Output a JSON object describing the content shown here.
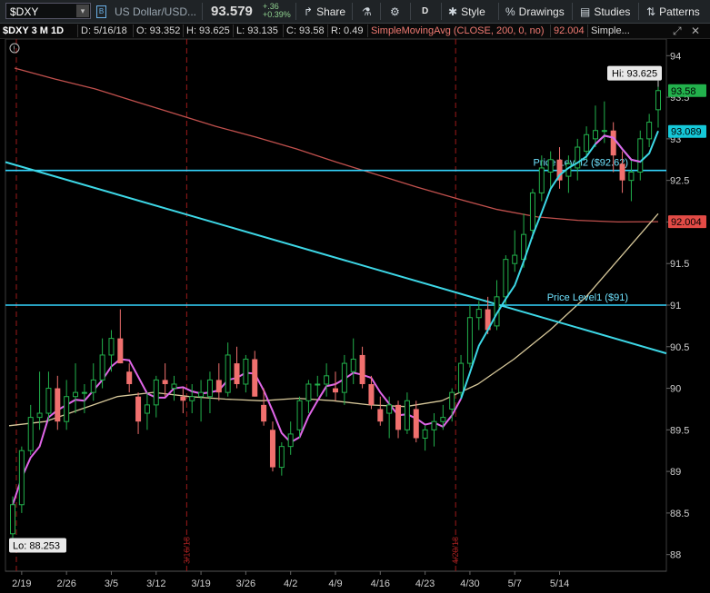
{
  "toolbar": {
    "symbol": "$DXY",
    "description": "US Dollar/USD...",
    "last": "93.579",
    "change": "+.36",
    "change_pct": "+0.39%",
    "period_button": "D",
    "buttons": {
      "share": "Share",
      "style": "Style",
      "drawings": "Drawings",
      "studies": "Studies",
      "patterns": "Patterns"
    }
  },
  "infobar": {
    "title": "$DXY 3 M 1D",
    "date": "D: 5/16/18",
    "open": "O: 93.352",
    "high": "H: 93.625",
    "low": "L: 93.135",
    "close": "C: 93.58",
    "range": "R: 0.49",
    "study": "SimpleMovingAvg (CLOSE, 200, 0, no)",
    "study_value": "92.004",
    "study2": "Simple..."
  },
  "colors": {
    "up": "#22b14c",
    "down": "#f0706e",
    "sma200": "#c0504d",
    "sma_fast": "#e066e8",
    "sma_slow": "#d7c89a",
    "trendline": "#3dd7e6",
    "level": "#35d6ff",
    "vline": "#9b1a1a"
  },
  "chart_data": {
    "type": "candlestick",
    "ylim": [
      87.8,
      94.2
    ],
    "y_ticks": [
      88,
      88.5,
      89,
      89.5,
      90,
      90.5,
      91,
      91.5,
      92,
      92.5,
      93,
      93.5,
      94
    ],
    "y_tick_labels": [
      "88",
      "88.5",
      "89",
      "89.5",
      "90",
      "90.5",
      "91",
      "91.5",
      "92",
      "92.5",
      "93",
      "93.5",
      "94"
    ],
    "x_ticks": [
      "2/19",
      "2/26",
      "3/5",
      "3/12",
      "3/19",
      "3/26",
      "4/2",
      "4/9",
      "4/16",
      "4/23",
      "4/30",
      "5/7",
      "5/14"
    ],
    "event_dates": [
      "3/16/18",
      "4/20/18"
    ],
    "candles": [
      {
        "o": 88.25,
        "h": 88.7,
        "l": 88.2,
        "c": 88.6
      },
      {
        "o": 88.6,
        "h": 89.3,
        "l": 88.5,
        "c": 89.25
      },
      {
        "o": 89.25,
        "h": 89.8,
        "l": 89.2,
        "c": 89.65
      },
      {
        "o": 89.65,
        "h": 90.2,
        "l": 89.5,
        "c": 89.7
      },
      {
        "o": 89.7,
        "h": 90.2,
        "l": 89.6,
        "c": 90.0
      },
      {
        "o": 90.0,
        "h": 90.15,
        "l": 89.5,
        "c": 89.6
      },
      {
        "o": 89.6,
        "h": 90.1,
        "l": 89.5,
        "c": 89.9
      },
      {
        "o": 89.9,
        "h": 90.3,
        "l": 89.7,
        "c": 89.95
      },
      {
        "o": 89.95,
        "h": 90.05,
        "l": 89.7,
        "c": 89.95
      },
      {
        "o": 89.95,
        "h": 90.3,
        "l": 89.85,
        "c": 90.1
      },
      {
        "o": 90.1,
        "h": 90.6,
        "l": 90.0,
        "c": 90.4
      },
      {
        "o": 90.4,
        "h": 90.7,
        "l": 90.2,
        "c": 90.6
      },
      {
        "o": 90.6,
        "h": 90.95,
        "l": 90.3,
        "c": 90.3
      },
      {
        "o": 90.2,
        "h": 90.3,
        "l": 89.95,
        "c": 90.05
      },
      {
        "o": 89.9,
        "h": 89.95,
        "l": 89.45,
        "c": 89.6
      },
      {
        "o": 89.7,
        "h": 89.95,
        "l": 89.5,
        "c": 89.8
      },
      {
        "o": 89.8,
        "h": 90.15,
        "l": 89.65,
        "c": 90.1
      },
      {
        "o": 90.1,
        "h": 90.3,
        "l": 89.9,
        "c": 90.05
      },
      {
        "o": 90.0,
        "h": 90.15,
        "l": 89.85,
        "c": 90.05
      },
      {
        "o": 89.9,
        "h": 90.0,
        "l": 89.7,
        "c": 89.85
      },
      {
        "o": 89.85,
        "h": 90.05,
        "l": 89.7,
        "c": 89.9
      },
      {
        "o": 89.9,
        "h": 90.1,
        "l": 89.6,
        "c": 89.95
      },
      {
        "o": 89.9,
        "h": 90.2,
        "l": 89.7,
        "c": 90.1
      },
      {
        "o": 90.1,
        "h": 90.3,
        "l": 89.85,
        "c": 89.95
      },
      {
        "o": 89.95,
        "h": 90.55,
        "l": 89.9,
        "c": 90.4
      },
      {
        "o": 90.3,
        "h": 90.5,
        "l": 90.0,
        "c": 90.05
      },
      {
        "o": 90.05,
        "h": 90.4,
        "l": 89.95,
        "c": 90.35
      },
      {
        "o": 90.35,
        "h": 90.45,
        "l": 89.9,
        "c": 89.9
      },
      {
        "o": 89.8,
        "h": 90.0,
        "l": 89.55,
        "c": 89.6
      },
      {
        "o": 89.5,
        "h": 89.6,
        "l": 89.0,
        "c": 89.05
      },
      {
        "o": 89.05,
        "h": 89.35,
        "l": 88.95,
        "c": 89.3
      },
      {
        "o": 89.3,
        "h": 89.6,
        "l": 89.2,
        "c": 89.45
      },
      {
        "o": 89.5,
        "h": 89.9,
        "l": 89.4,
        "c": 89.85
      },
      {
        "o": 89.85,
        "h": 90.1,
        "l": 89.7,
        "c": 90.05
      },
      {
        "o": 90.05,
        "h": 90.15,
        "l": 89.9,
        "c": 90.05
      },
      {
        "o": 90.05,
        "h": 90.3,
        "l": 89.9,
        "c": 90.15
      },
      {
        "o": 90.0,
        "h": 90.2,
        "l": 89.85,
        "c": 89.95
      },
      {
        "o": 89.95,
        "h": 90.4,
        "l": 89.8,
        "c": 90.3
      },
      {
        "o": 90.2,
        "h": 90.6,
        "l": 90.05,
        "c": 90.35
      },
      {
        "o": 90.4,
        "h": 90.5,
        "l": 90.0,
        "c": 90.05
      },
      {
        "o": 90.05,
        "h": 90.15,
        "l": 89.75,
        "c": 89.8
      },
      {
        "o": 89.75,
        "h": 89.9,
        "l": 89.55,
        "c": 89.6
      },
      {
        "o": 89.7,
        "h": 89.9,
        "l": 89.4,
        "c": 89.8
      },
      {
        "o": 89.8,
        "h": 89.85,
        "l": 89.4,
        "c": 89.5
      },
      {
        "o": 89.5,
        "h": 89.95,
        "l": 89.45,
        "c": 89.85
      },
      {
        "o": 89.75,
        "h": 89.85,
        "l": 89.35,
        "c": 89.4
      },
      {
        "o": 89.4,
        "h": 89.55,
        "l": 89.25,
        "c": 89.5
      },
      {
        "o": 89.5,
        "h": 89.7,
        "l": 89.3,
        "c": 89.6
      },
      {
        "o": 89.6,
        "h": 89.8,
        "l": 89.5,
        "c": 89.65
      },
      {
        "o": 89.75,
        "h": 90.0,
        "l": 89.6,
        "c": 89.95
      },
      {
        "o": 89.95,
        "h": 90.4,
        "l": 89.9,
        "c": 90.3
      },
      {
        "o": 90.3,
        "h": 91.0,
        "l": 90.25,
        "c": 90.85
      },
      {
        "o": 90.85,
        "h": 91.05,
        "l": 90.7,
        "c": 90.95
      },
      {
        "o": 90.95,
        "h": 91.1,
        "l": 90.65,
        "c": 90.7
      },
      {
        "o": 90.75,
        "h": 91.3,
        "l": 90.7,
        "c": 91.1
      },
      {
        "o": 91.1,
        "h": 91.6,
        "l": 91.0,
        "c": 91.55
      },
      {
        "o": 91.5,
        "h": 91.9,
        "l": 91.4,
        "c": 91.6
      },
      {
        "o": 91.55,
        "h": 92.1,
        "l": 91.45,
        "c": 91.85
      },
      {
        "o": 91.9,
        "h": 92.4,
        "l": 91.8,
        "c": 92.35
      },
      {
        "o": 92.35,
        "h": 92.8,
        "l": 92.25,
        "c": 92.65
      },
      {
        "o": 92.6,
        "h": 92.85,
        "l": 92.4,
        "c": 92.75
      },
      {
        "o": 92.75,
        "h": 92.9,
        "l": 92.4,
        "c": 92.5
      },
      {
        "o": 92.55,
        "h": 92.8,
        "l": 92.35,
        "c": 92.7
      },
      {
        "o": 92.65,
        "h": 93.0,
        "l": 92.5,
        "c": 92.9
      },
      {
        "o": 92.85,
        "h": 93.15,
        "l": 92.75,
        "c": 93.05
      },
      {
        "o": 93.0,
        "h": 93.4,
        "l": 92.9,
        "c": 93.1
      },
      {
        "o": 93.1,
        "h": 93.45,
        "l": 92.95,
        "c": 93.1
      },
      {
        "o": 93.1,
        "h": 93.2,
        "l": 92.6,
        "c": 92.8
      },
      {
        "o": 92.7,
        "h": 92.85,
        "l": 92.35,
        "c": 92.5
      },
      {
        "o": 92.5,
        "h": 92.75,
        "l": 92.25,
        "c": 92.6
      },
      {
        "o": 92.6,
        "h": 93.1,
        "l": 92.5,
        "c": 93.0
      },
      {
        "o": 93.0,
        "h": 93.3,
        "l": 92.9,
        "c": 93.2
      },
      {
        "o": 93.35,
        "h": 93.625,
        "l": 93.135,
        "c": 93.58
      }
    ],
    "sma200": [
      93.85,
      93.72,
      93.6,
      93.45,
      93.3,
      93.15,
      93.02,
      92.88,
      92.72,
      92.57,
      92.42,
      92.28,
      92.15,
      92.06,
      92.02,
      92.0,
      92.004
    ],
    "sma_slow": [
      89.55,
      89.6,
      89.75,
      89.9,
      89.95,
      89.9,
      89.87,
      89.85,
      89.88,
      89.85,
      89.8,
      89.78,
      89.85,
      90.05,
      90.35,
      90.7,
      91.1,
      91.6,
      92.1
    ],
    "sma_fast_value": "93.089",
    "last_value_label": "93.58",
    "sma200_value_label": "92.004",
    "hi_label": "Hi: 93.625",
    "lo_label": "Lo: 88.253",
    "levels": [
      {
        "label": "Price Level2 ($92.62)",
        "value": 92.62
      },
      {
        "label": "Price Level1 ($91)",
        "value": 91.0
      }
    ],
    "trendline": {
      "y_start": 92.72,
      "y_end": 90.42
    }
  }
}
